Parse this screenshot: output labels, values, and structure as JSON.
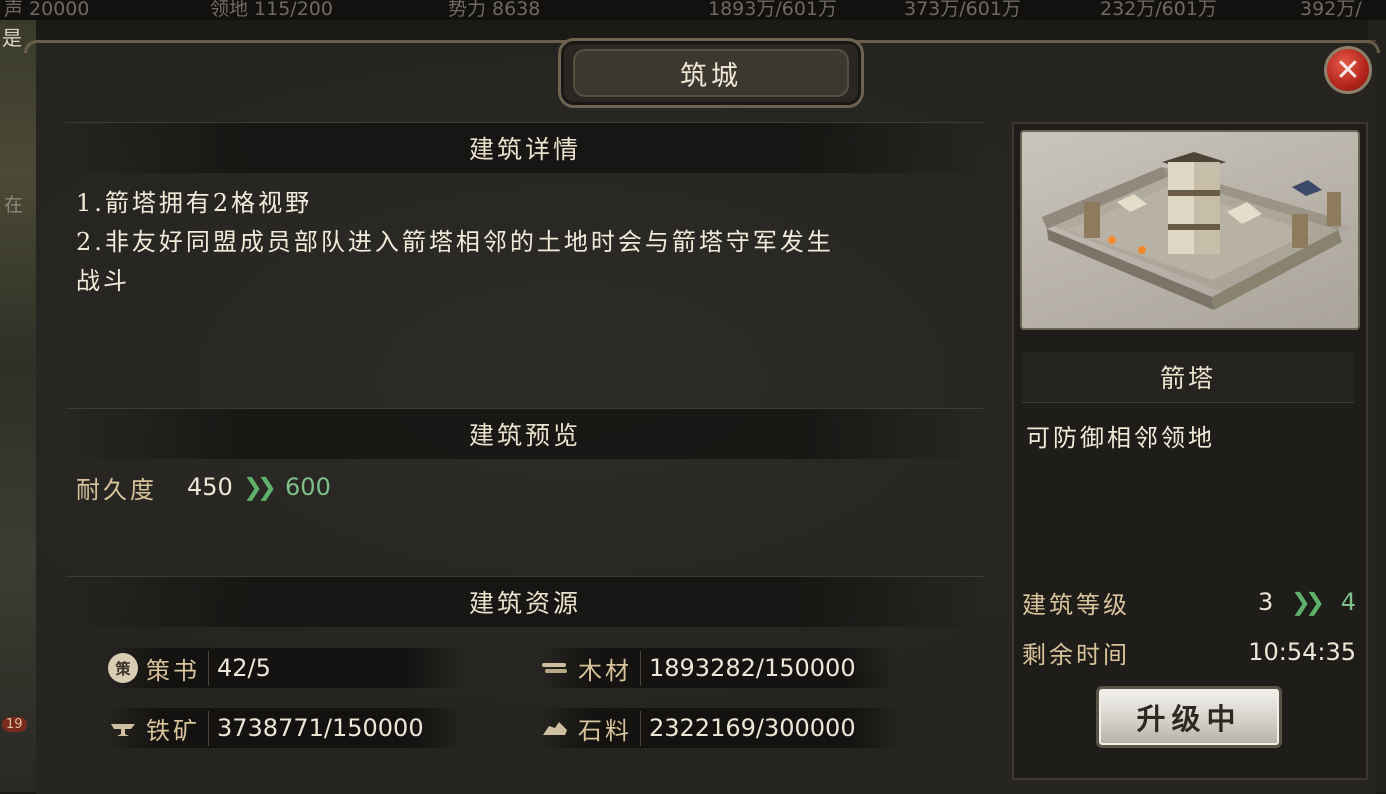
{
  "hud": {
    "items": [
      "声 20000",
      "领地 115/200",
      "势力 8638",
      "1893万/601万",
      "373万/601万",
      "232万/601万",
      "392万/"
    ]
  },
  "background": {
    "left_text_1": "是",
    "left_text_2": "在",
    "left_badge": "19"
  },
  "dialog": {
    "title": "筑城",
    "close_icon": "close-icon"
  },
  "details": {
    "heading": "建筑详情",
    "lines": [
      "1.箭塔拥有2格视野",
      "2.非友好同盟成员部队进入箭塔相邻的土地时会与箭塔守军发生",
      "战斗"
    ]
  },
  "preview": {
    "heading": "建筑预览",
    "stat_label": "耐久度",
    "stat_old": "450",
    "stat_arrow": "»",
    "stat_new": "600",
    "arrow_color": "#5fb06a"
  },
  "resources": {
    "heading": "建筑资源",
    "items": [
      {
        "icon": "book-seal-icon",
        "icon_text": "策",
        "label": "策书",
        "value": "42/5"
      },
      {
        "icon": "wood-icon",
        "icon_text": "",
        "label": "木材",
        "value": "1893282/150000"
      },
      {
        "icon": "iron-icon",
        "icon_text": "",
        "label": "铁矿",
        "value": "3738771/150000"
      },
      {
        "icon": "stone-icon",
        "icon_text": "",
        "label": "石料",
        "value": "2322169/300000"
      }
    ]
  },
  "building": {
    "name": "箭塔",
    "description": "可防御相邻领地",
    "level_label": "建筑等级",
    "level_old": "3",
    "level_arrow": "»",
    "level_new": "4",
    "time_label": "剩余时间",
    "time_value": "10:54:35",
    "upgrade_button": "升级中"
  }
}
